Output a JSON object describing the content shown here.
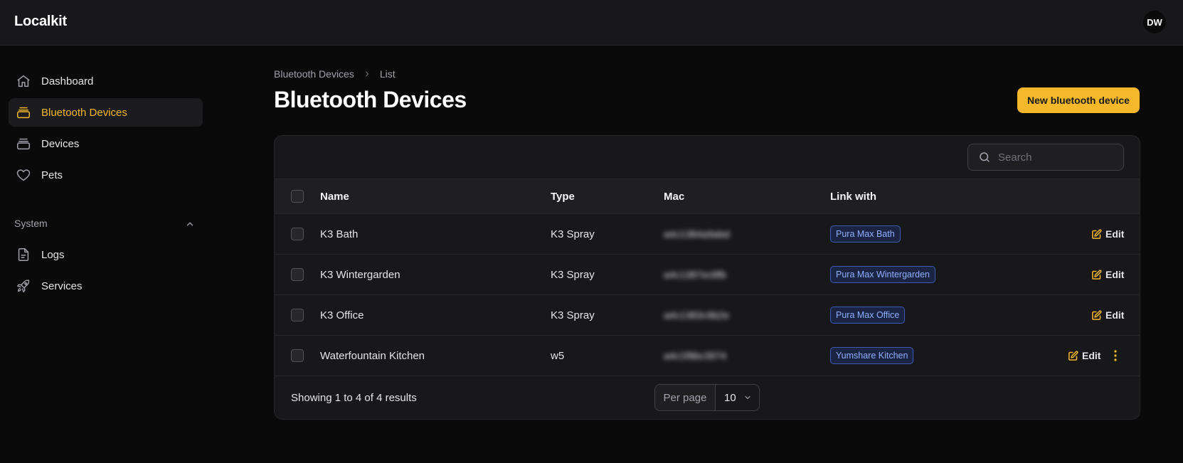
{
  "app": {
    "name": "Localkit",
    "user_initials": "DW"
  },
  "sidebar": {
    "items": [
      {
        "label": "Dashboard",
        "icon": "home-icon"
      },
      {
        "label": "Bluetooth Devices",
        "icon": "box-icon",
        "active": true
      },
      {
        "label": "Devices",
        "icon": "box-icon"
      },
      {
        "label": "Pets",
        "icon": "heart-icon"
      }
    ],
    "group": {
      "label": "System",
      "expanded": true
    },
    "system_items": [
      {
        "label": "Logs",
        "icon": "document-icon"
      },
      {
        "label": "Services",
        "icon": "rocket-icon"
      }
    ]
  },
  "breadcrumb": {
    "parent": "Bluetooth Devices",
    "current": "List"
  },
  "page": {
    "title": "Bluetooth Devices",
    "new_button": "New bluetooth device"
  },
  "search": {
    "placeholder": "Search",
    "value": ""
  },
  "table": {
    "columns": {
      "name": "Name",
      "type": "Type",
      "mac": "Mac",
      "link": "Link with"
    },
    "rows": [
      {
        "name": "K3 Bath",
        "type": "K3 Spray",
        "mac": "a4c1384a9abd",
        "link": "Pura Max Bath",
        "action": "Edit"
      },
      {
        "name": "K3 Wintergarden",
        "type": "K3 Spray",
        "mac": "a4c1387ec8fb",
        "link": "Pura Max Wintergarden",
        "action": "Edit"
      },
      {
        "name": "K3 Office",
        "type": "K3 Spray",
        "mac": "a4c1383c9b2e",
        "link": "Pura Max Office",
        "action": "Edit"
      },
      {
        "name": "Waterfountain Kitchen",
        "type": "w5",
        "mac": "a4c1f8bc3974",
        "link": "Yumshare Kitchen",
        "action": "Edit"
      }
    ]
  },
  "footer": {
    "showing": "Showing 1 to 4 of 4 results",
    "per_page_label": "Per page",
    "per_page_value": "10"
  },
  "colors": {
    "accent": "#f5b82a",
    "badge_text": "#8fb0ff",
    "background": "#0a0a0b",
    "surface": "#18181b"
  }
}
